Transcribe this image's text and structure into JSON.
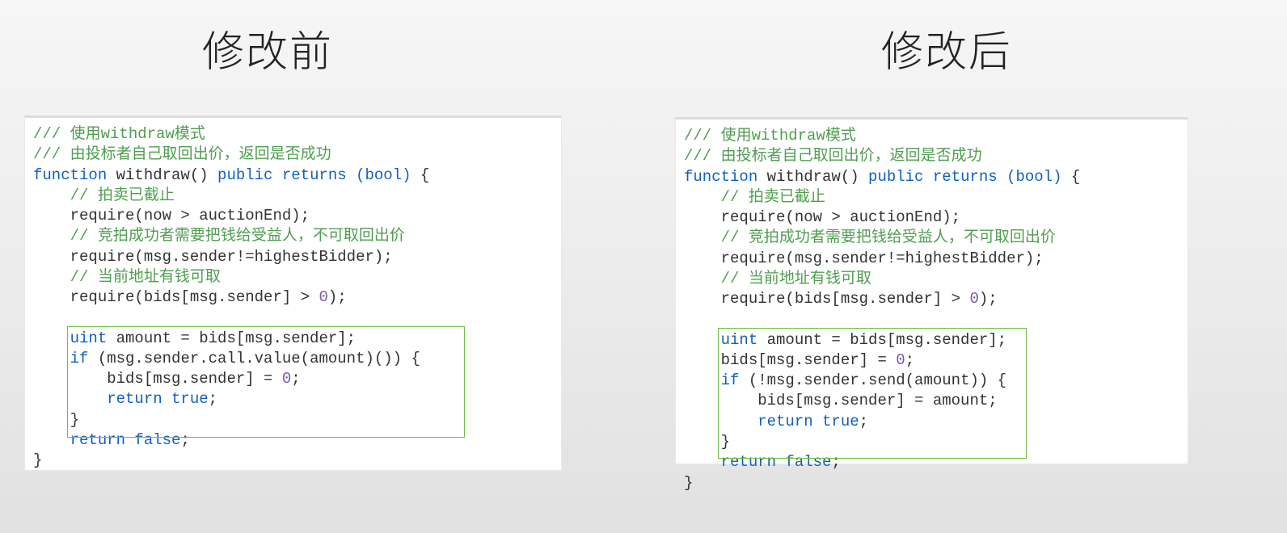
{
  "headings": {
    "left": "修改前",
    "right": "修改后"
  },
  "codeLeft": {
    "c1": "/// 使用",
    "c1b": "withdraw",
    "c1c": "模式",
    "c2": "/// 由投标者自己取回出价，返回是否成功",
    "l3_fn": "function",
    "l3_name": " withdraw() ",
    "l3_pub": "public",
    "l3_ret": " returns ",
    "l3_bool": "(bool)",
    "l3_brace": " {",
    "c4": "    // 拍卖已截止",
    "l5": "    require(now > auctionEnd);",
    "c6": "    // 竞拍成功者需要把钱给受益人，不可取回出价",
    "l7": "    require(msg.sender!=highestBidder);",
    "c8": "    // 当前地址有钱可取",
    "l9a": "    require(bids[msg.sender] > ",
    "l9num": "0",
    "l9b": ");",
    "blank": "",
    "l11a": "    uint",
    "l11b": " amount = bids[msg.sender];",
    "l12a": "    if",
    "l12b": " (msg.sender.call.value(amount)()) {",
    "l13a": "        bids[msg.sender] = ",
    "l13num": "0",
    "l13b": ";",
    "l14a": "        return ",
    "l14true": "true",
    "l14b": ";",
    "l15": "    }",
    "l16a": "    return ",
    "l16false": "false",
    "l16b": ";",
    "l17": "}"
  },
  "codeRight": {
    "c1": "/// 使用",
    "c1b": "withdraw",
    "c1c": "模式",
    "c2": "/// 由投标者自己取回出价，返回是否成功",
    "l3_fn": "function",
    "l3_name": " withdraw() ",
    "l3_pub": "public",
    "l3_ret": " returns ",
    "l3_bool": "(bool)",
    "l3_brace": " {",
    "c4": "    // 拍卖已截止",
    "l5": "    require(now > auctionEnd);",
    "c6": "    // 竞拍成功者需要把钱给受益人，不可取回出价",
    "l7": "    require(msg.sender!=highestBidder);",
    "c8": "    // 当前地址有钱可取",
    "l9a": "    require(bids[msg.sender] > ",
    "l9num": "0",
    "l9b": ");",
    "blank": "",
    "l11a": "    uint",
    "l11b": " amount = bids[msg.sender];",
    "l12a": "    bids[msg.sender] = ",
    "l12num": "0",
    "l12b": ";",
    "l13a": "    if",
    "l13b": " (!msg.sender.send(amount)) {",
    "l14": "        bids[msg.sender] = amount;",
    "l15a": "        return ",
    "l15true": "true",
    "l15b": ";",
    "l16": "    }",
    "l17a": "    return ",
    "l17false": "false",
    "l17b": ";",
    "l18": "}"
  }
}
